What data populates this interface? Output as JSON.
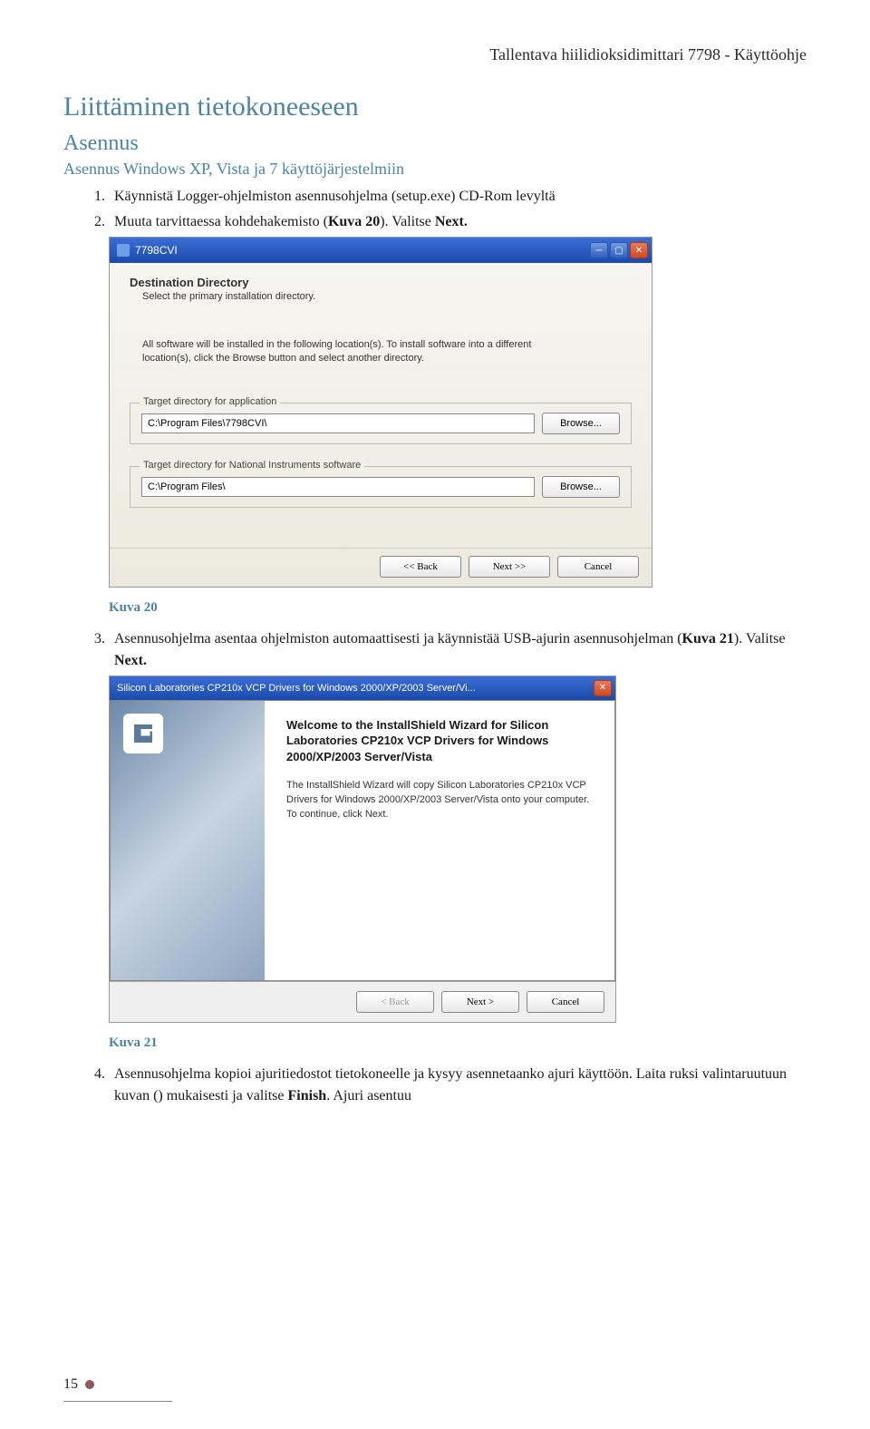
{
  "header": {
    "title": "Tallentava hiilidioksidimittari 7798 - Käyttöohje"
  },
  "h1": "Liittäminen tietokoneeseen",
  "h2": "Asennus",
  "h3": "Asennus Windows XP, Vista ja 7 käyttöjärjestelmiin",
  "steps1": {
    "s1": "Käynnistä Logger-ohjelmiston asennusohjelma (setup.exe) CD-Rom levyltä",
    "s2_a": "Muuta tarvittaessa kohdehakemisto (",
    "s2_b": "Kuva 20",
    "s2_c": "). Valitse ",
    "s2_d": "Next."
  },
  "installer1": {
    "window_title": "7798CVI",
    "heading": "Destination Directory",
    "sub": "Select the primary installation directory.",
    "desc": "All software will be installed in the following location(s). To install software into a different location(s), click the Browse button and select another directory.",
    "group1_legend": "Target directory for application",
    "group1_path": "C:\\Program Files\\7798CVI\\",
    "group2_legend": "Target directory for National Instruments software",
    "group2_path": "C:\\Program Files\\",
    "browse": "Browse...",
    "back": "<< Back",
    "next": "Next >>",
    "cancel": "Cancel"
  },
  "caption1": "Kuva 20",
  "steps2": {
    "s3_a": "Asennusohjelma asentaa ohjelmiston automaattisesti ja käynnistää USB-ajurin asennusohjelman (",
    "s3_b": "Kuva 21",
    "s3_c": "). Valitse ",
    "s3_d": "Next."
  },
  "installer2": {
    "window_title": "Silicon Laboratories CP210x VCP Drivers for Windows 2000/XP/2003 Server/Vi...",
    "welcome": "Welcome to the InstallShield Wizard for Silicon Laboratories CP210x VCP Drivers for Windows 2000/XP/2003 Server/Vista",
    "desc": "The InstallShield Wizard will copy Silicon Laboratories CP210x VCP Drivers for Windows 2000/XP/2003 Server/Vista onto your computer. To continue, click Next.",
    "back": "< Back",
    "next": "Next >",
    "cancel": "Cancel"
  },
  "caption2": "Kuva 21",
  "steps3": {
    "s4_a": "Asennusohjelma kopioi ajuritiedostot tietokoneelle ja kysyy asennetaanko ajuri käyttöön. Laita ruksi valintaruutuun kuvan () mukaisesti ja valitse ",
    "s4_b": "Finish",
    "s4_c": ". Ajuri asentuu"
  },
  "footer": {
    "page": "15"
  }
}
